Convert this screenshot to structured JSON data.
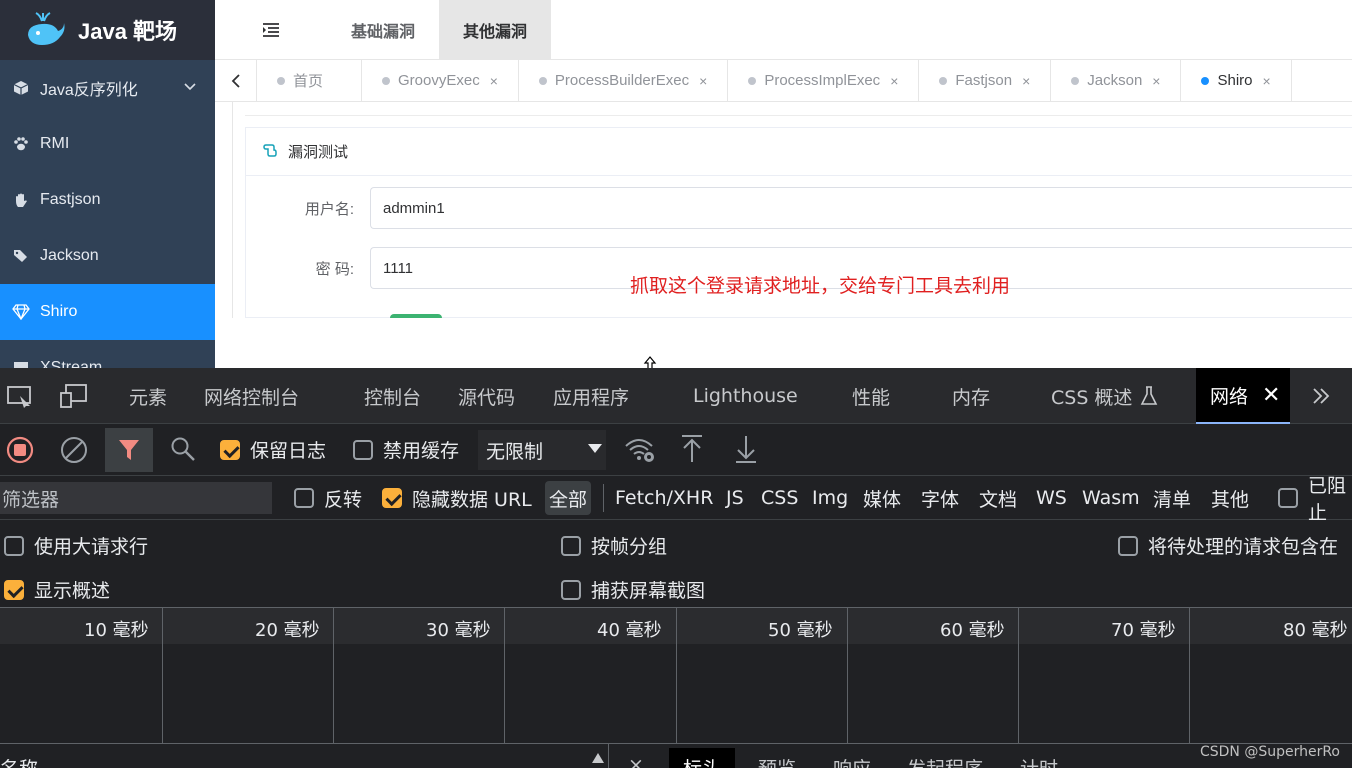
{
  "app": {
    "brand": "Java 靶场",
    "sidebar": [
      {
        "label": "Java反序列化",
        "icon": "cube-icon"
      },
      {
        "label": "RMI",
        "icon": "paw-icon"
      },
      {
        "label": "Fastjson",
        "icon": "hand-icon"
      },
      {
        "label": "Jackson",
        "icon": "tags-icon"
      },
      {
        "label": "Shiro",
        "icon": "diamond-icon"
      },
      {
        "label": "XStream",
        "icon": "box-icon"
      }
    ],
    "nav_tabs": [
      "基础漏洞",
      "其他漏洞"
    ],
    "page_tags": [
      {
        "label": "首页"
      },
      {
        "label": "GroovyExec",
        "close": "×"
      },
      {
        "label": "ProcessBuilderExec",
        "close": "×"
      },
      {
        "label": "ProcessImplExec",
        "close": "×"
      },
      {
        "label": "Fastjson",
        "close": "×"
      },
      {
        "label": "Jackson",
        "close": "×"
      },
      {
        "label": "Shiro",
        "close": "×"
      }
    ],
    "card_title": "漏洞测试",
    "username_label": "用户名:",
    "username_value": "admmin1",
    "password_label": "密 码:",
    "password_value": "1111",
    "annotation": "抓取这个登录请求地址，交给专门工具去利用",
    "annotation_color": "#e02020"
  },
  "devtools": {
    "tabs": [
      "元素",
      "网络控制台",
      "控制台",
      "源代码",
      "应用程序",
      "Lighthouse",
      "性能",
      "内存",
      "CSS 概述",
      "网络"
    ],
    "toolbar": {
      "preserve_log": "保留日志",
      "disable_cache": "禁用缓存",
      "throttle": "无限制"
    },
    "filter": {
      "placeholder": "筛选器",
      "invert": "反转",
      "hide_data_url": "隐藏数据 URL",
      "types": [
        "全部",
        "Fetch/XHR",
        "JS",
        "CSS",
        "Img",
        "媒体",
        "字体",
        "文档",
        "WS",
        "Wasm",
        "清单",
        "其他"
      ],
      "blocked": "已阻止"
    },
    "options": {
      "big_rows": "使用大请求行",
      "group_by_frame": "按帧分组",
      "include_pending": "将待处理的请求包含在",
      "show_overview": "显示概述",
      "capture_screenshots": "捕获屏幕截图"
    },
    "timeline_ticks": [
      "10 毫秒",
      "20 毫秒",
      "30 毫秒",
      "40 毫秒",
      "50 毫秒",
      "60 毫秒",
      "70 毫秒",
      "80 毫秒"
    ],
    "bottom": {
      "name_header": "名称",
      "close": "×",
      "tabs": [
        "标头",
        "预览",
        "响应",
        "发起程序",
        "计时"
      ]
    },
    "watermark": "CSDN @SuperherRo"
  }
}
